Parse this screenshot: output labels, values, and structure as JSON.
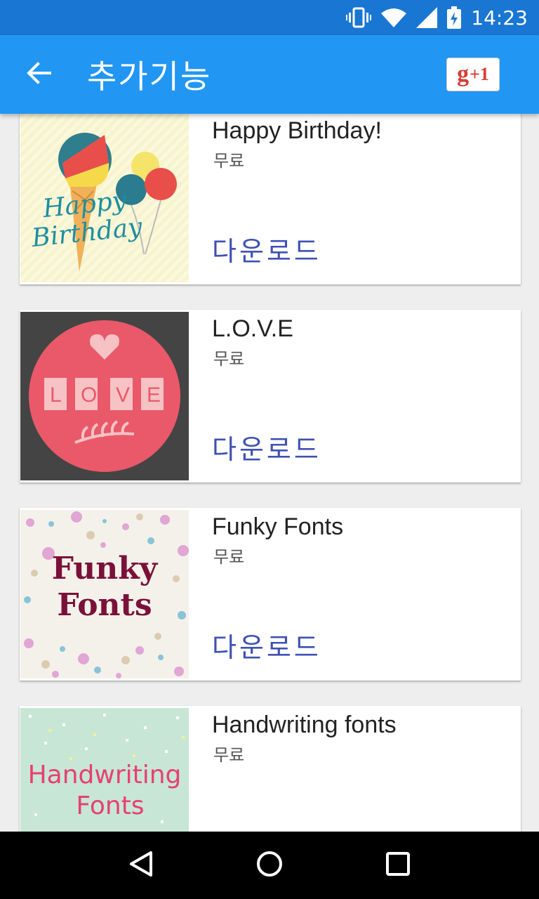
{
  "status_bar": {
    "time": "14:23",
    "icons": [
      "vibrate-icon",
      "wifi-icon",
      "signal-icon",
      "battery-charging-icon"
    ]
  },
  "app_bar": {
    "title": "추가기능",
    "back_icon": "arrow-back-icon",
    "gplus": {
      "g": "g",
      "plus": "+1"
    }
  },
  "items": [
    {
      "name": "Happy Birthday!",
      "price": "무료",
      "action": "다운로드",
      "thumb_text": [
        "Happy",
        "Birthday"
      ]
    },
    {
      "name": "L.O.V.E",
      "price": "무료",
      "action": "다운로드",
      "thumb_text": [
        "L",
        "O",
        "V",
        "E"
      ]
    },
    {
      "name": "Funky Fonts",
      "price": "무료",
      "action": "다운로드",
      "thumb_text": [
        "Funky",
        "Fonts"
      ]
    },
    {
      "name": "Handwriting fonts",
      "price": "무료",
      "thumb_text": [
        "Handwriting",
        "Fonts"
      ]
    }
  ],
  "colors": {
    "status_bar": "#1976d2",
    "app_bar": "#2196f3",
    "accent": "#3f51b5",
    "background": "#eeeeee"
  },
  "nav_bar": {
    "icons": [
      "back-triangle-icon",
      "home-circle-icon",
      "recents-square-icon"
    ]
  }
}
